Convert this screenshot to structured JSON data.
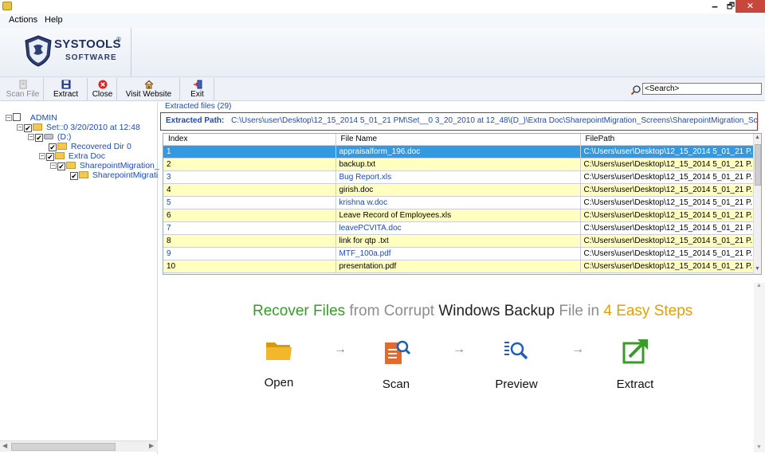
{
  "menu": {
    "actions": "Actions",
    "help": "Help"
  },
  "window_controls": {
    "minimize": "🗕",
    "maximize": "🗗",
    "close": "✕"
  },
  "logo": {
    "name": "SYSTOOLS",
    "sub": "SOFTWARE",
    "reg": "®"
  },
  "toolbar": {
    "scan_file": "Scan File",
    "extract": "Extract",
    "close": "Close",
    "visit_website": "Visit Website",
    "exit": "Exit"
  },
  "search": {
    "value": "<Search>"
  },
  "tree": {
    "admin": "ADMIN",
    "set": "Set::0  3/20/2010 at 12:48",
    "drive": "(D:)",
    "recovered_dir": "Recovered Dir 0",
    "extra_doc": "Extra Doc",
    "sharepoint_1": "SharepointMigration_",
    "sharepoint_2": "SharepointMigrati"
  },
  "extracted": {
    "count_label": "Extracted files (29)",
    "path_label": "Extracted Path:",
    "path_value": "C:\\Users\\user\\Desktop\\12_15_2014 5_01_21 PM\\Set__0  3_20_2010 at 12_48\\(D_)\\Extra Doc\\SharepointMigration_Screens\\SharepointMigration_Screens"
  },
  "table": {
    "headers": [
      "Index",
      "File Name",
      "FilePath"
    ],
    "rows": [
      {
        "index": "1",
        "name": "appraisalform_196.doc",
        "path": "C:\\Users\\user\\Desktop\\12_15_2014 5_01_21 P..."
      },
      {
        "index": "2",
        "name": "backup.txt",
        "path": "C:\\Users\\user\\Desktop\\12_15_2014 5_01_21 P..."
      },
      {
        "index": "3",
        "name": "Bug Report.xls",
        "path": "C:\\Users\\user\\Desktop\\12_15_2014 5_01_21 P..."
      },
      {
        "index": "4",
        "name": "girish.doc",
        "path": "C:\\Users\\user\\Desktop\\12_15_2014 5_01_21 P..."
      },
      {
        "index": "5",
        "name": "krishna w.doc",
        "path": "C:\\Users\\user\\Desktop\\12_15_2014 5_01_21 P..."
      },
      {
        "index": "6",
        "name": "Leave Record of Employees.xls",
        "path": "C:\\Users\\user\\Desktop\\12_15_2014 5_01_21 P..."
      },
      {
        "index": "7",
        "name": "leavePCVITA.doc",
        "path": "C:\\Users\\user\\Desktop\\12_15_2014 5_01_21 P..."
      },
      {
        "index": "8",
        "name": "link for qtp .txt",
        "path": "C:\\Users\\user\\Desktop\\12_15_2014 5_01_21 P..."
      },
      {
        "index": "9",
        "name": "MTF_100a.pdf",
        "path": "C:\\Users\\user\\Desktop\\12_15_2014 5_01_21 P..."
      },
      {
        "index": "10",
        "name": "presentation.pdf",
        "path": "C:\\Users\\user\\Desktop\\12_15_2014 5_01_21 P..."
      }
    ]
  },
  "promo": {
    "t1": "Recover Files",
    "t2": " from Corrupt ",
    "t3": "Windows Backup",
    "t4": " File in ",
    "t5": "4 Easy Steps",
    "steps": [
      "Open",
      "Scan",
      "Preview",
      "Extract"
    ],
    "arrow": "→"
  },
  "colors": {
    "accent_blue": "#1f4bb0",
    "selected_row": "#3399e0",
    "alt_row": "#ffffc0",
    "path_border": "#d22020",
    "promo_green": "#3a9a2a",
    "promo_orange": "#e0a100"
  }
}
